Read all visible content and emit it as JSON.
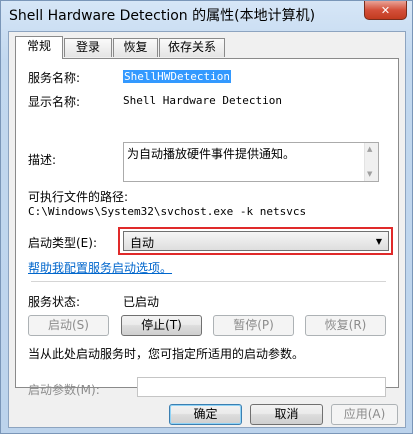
{
  "window": {
    "title": "Shell Hardware Detection 的属性(本地计算机)",
    "close_glyph": "✕"
  },
  "tabs": [
    {
      "label": "常规",
      "active": true
    },
    {
      "label": "登录",
      "active": false
    },
    {
      "label": "恢复",
      "active": false
    },
    {
      "label": "依存关系",
      "active": false
    }
  ],
  "general": {
    "service_name_label": "服务名称:",
    "service_name_value": "ShellHWDetection",
    "display_name_label": "显示名称:",
    "display_name_value": "Shell Hardware Detection",
    "description_label": "描述:",
    "description_value": "为自动播放硬件事件提供通知。",
    "exe_path_label": "可执行文件的路径:",
    "exe_path_value": "C:\\Windows\\System32\\svchost.exe -k netsvcs",
    "startup_type_label": "启动类型(E):",
    "startup_type_value": "自动",
    "help_link": "帮助我配置服务启动选项。",
    "status_label": "服务状态:",
    "status_value": "已启动",
    "start_button": "启动(S)",
    "stop_button": "停止(T)",
    "pause_button": "暂停(P)",
    "resume_button": "恢复(R)",
    "hint_text": "当从此处启动服务时，您可指定所适用的启动参数。",
    "start_params_label": "启动参数(M):",
    "start_params_value": ""
  },
  "footer": {
    "ok_button": "确定",
    "cancel_button": "取消",
    "apply_button": "应用(A)"
  },
  "colors": {
    "highlight": "#e02a2a",
    "link": "#0066cc",
    "selection": "#3399ff"
  }
}
